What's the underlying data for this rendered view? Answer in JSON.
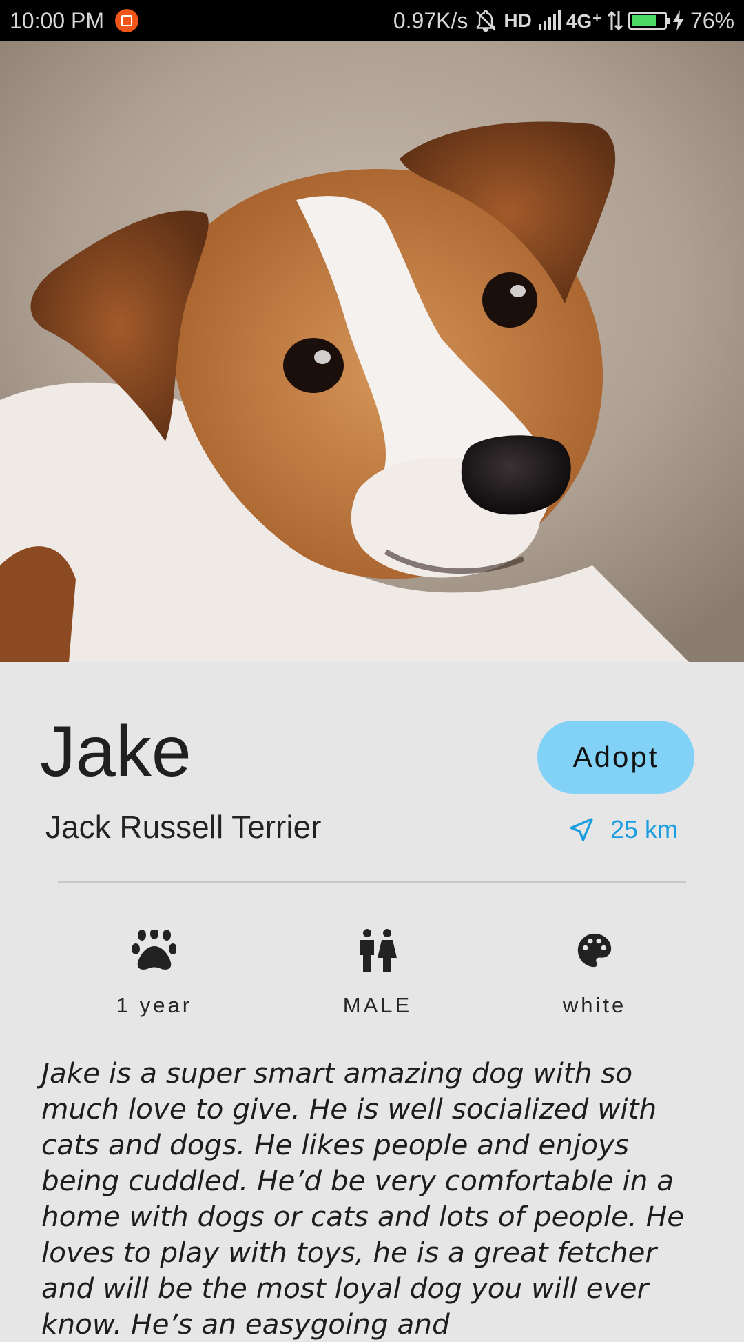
{
  "status_bar": {
    "time": "10:00 PM",
    "net_speed": "0.97K/s",
    "hd": "HD",
    "network": "4G⁺",
    "battery_percent": "76%",
    "battery_level": 0.76
  },
  "pet": {
    "name": "Jake",
    "breed": "Jack Russell Terrier",
    "distance": "25 km",
    "adopt_label": "Adopt",
    "attributes": {
      "age": "1 year",
      "sex": "MALE",
      "color": "white"
    },
    "description": "Jake is a super smart amazing dog with so much love to give. He is well socialized with cats and dogs. He likes people and enjoys being cuddled. He’d be very comfortable in a home with dogs or cats and lots of people. He loves to play with toys, he is a great fetcher and will be the most loyal dog you will ever know. He’s an easygoing and"
  },
  "icons": {
    "status_notification": "app-notification-icon",
    "silent": "bell-off-icon",
    "signal": "signal-icon",
    "data": "data-arrows-icon",
    "battery": "battery-icon",
    "charging": "charging-bolt-icon",
    "distance": "navigation-arrow-icon",
    "age": "paw-icon",
    "sex": "male-female-icon",
    "color": "palette-icon"
  },
  "colors": {
    "accent": "#1a9de0",
    "adopt_button": "#82d2f8",
    "background": "#e6e6e6"
  }
}
